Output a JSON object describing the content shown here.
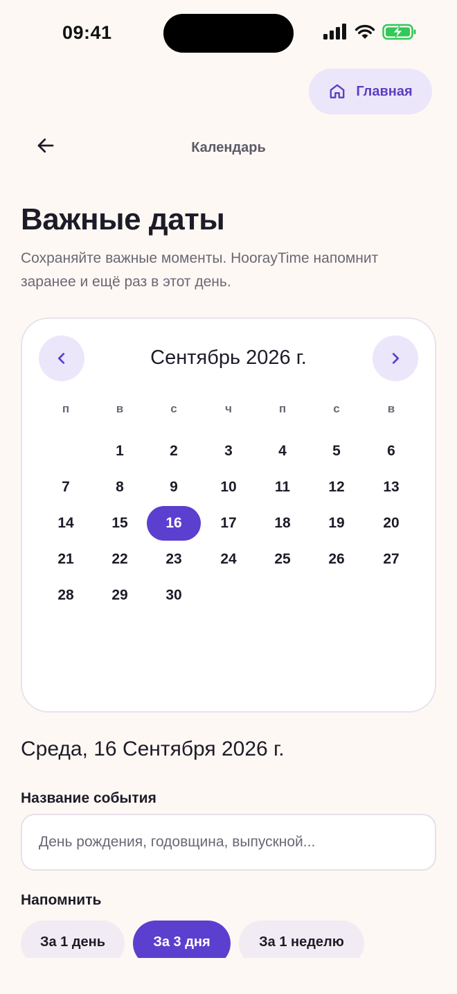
{
  "status_bar": {
    "time": "09:41"
  },
  "header": {
    "home_label": "Главная",
    "nav_title": "Календарь"
  },
  "page": {
    "title": "Важные даты",
    "subtitle": "Сохраняйте важные моменты. HoorayTime напомнит заранее и ещё раз в этот день."
  },
  "calendar": {
    "month_label": "Сентябрь 2026 г.",
    "weekdays": [
      "п",
      "в",
      "с",
      "ч",
      "п",
      "с",
      "в"
    ],
    "weeks": [
      [
        "",
        "1",
        "2",
        "3",
        "4",
        "5",
        "6"
      ],
      [
        "7",
        "8",
        "9",
        "10",
        "11",
        "12",
        "13"
      ],
      [
        "14",
        "15",
        "16",
        "17",
        "18",
        "19",
        "20"
      ],
      [
        "21",
        "22",
        "23",
        "24",
        "25",
        "26",
        "27"
      ],
      [
        "28",
        "29",
        "30",
        "",
        "",
        "",
        ""
      ]
    ],
    "selected_day": "16"
  },
  "selected_date_label": "Среда, 16 Сентября 2026 г.",
  "event_name": {
    "label": "Название события",
    "value": "",
    "placeholder": "День рождения, годовщина, выпускной..."
  },
  "remind": {
    "label": "Напомнить",
    "options": [
      "За 1 день",
      "За 3 дня",
      "За 1 неделю"
    ],
    "selected": "За 3 дня"
  },
  "colors": {
    "accent": "#5b3fcf",
    "accent_soft": "#ece6fb",
    "background": "#fdf8f3",
    "battery": "#34c759"
  }
}
